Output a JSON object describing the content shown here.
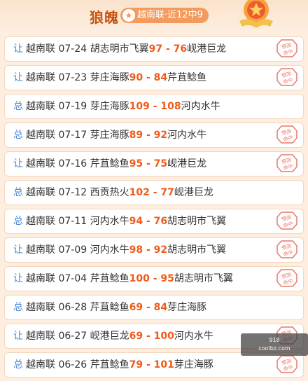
{
  "header": {
    "title": "狼魄",
    "badge": "越南联·近12中9"
  },
  "rows": [
    {
      "type": "让",
      "prefix": "越南联 07-24 胡志明市飞翼",
      "score": "97 - 76",
      "suffix": "岘港巨龙",
      "hit": true
    },
    {
      "type": "让",
      "prefix": "越南联 07-23 芽庄海豚",
      "score": "90 - 84",
      "suffix": "芹苴鲶鱼",
      "hit": true
    },
    {
      "type": "总",
      "prefix": "越南联 07-19 芽庄海豚",
      "score": "109 - 108",
      "suffix": "河内水牛",
      "hit": false
    },
    {
      "type": "总",
      "prefix": "越南联 07-17 芽庄海豚",
      "score": "89 - 92",
      "suffix": "河内水牛",
      "hit": true
    },
    {
      "type": "让",
      "prefix": "越南联 07-16 芹苴鲶鱼",
      "score": "95 - 75",
      "suffix": "岘港巨龙",
      "hit": true
    },
    {
      "type": "总",
      "prefix": "越南联 07-12 西贡热火",
      "score": "102 - 77",
      "suffix": "岘港巨龙",
      "hit": false
    },
    {
      "type": "总",
      "prefix": "越南联 07-11 河内水牛",
      "score": "94 - 76",
      "suffix": "胡志明市飞翼",
      "hit": true
    },
    {
      "type": "让",
      "prefix": "越南联 07-09 河内水牛",
      "score": "98 - 92",
      "suffix": "胡志明市飞翼",
      "hit": true
    },
    {
      "type": "让",
      "prefix": "越南联 07-04 芹苴鲶鱼",
      "score": "100 - 95",
      "suffix": "胡志明市飞翼",
      "hit": true
    },
    {
      "type": "总",
      "prefix": "越南联 06-28 芹苴鲶鱼",
      "score": "69 - 84",
      "suffix": "芽庄海豚",
      "hit": false
    },
    {
      "type": "让",
      "prefix": "越南联 06-27 岘港巨龙",
      "score": "69 - 100",
      "suffix": "河内水牛",
      "hit": true
    },
    {
      "type": "总",
      "prefix": "越南联 06-26 芹苴鲶鱼",
      "score": "79 - 101",
      "suffix": "芽庄海豚",
      "hit": true
    }
  ],
  "stamp_text": "预测命中",
  "toast": {
    "line1": "918",
    "line2": "coolbz.com"
  }
}
